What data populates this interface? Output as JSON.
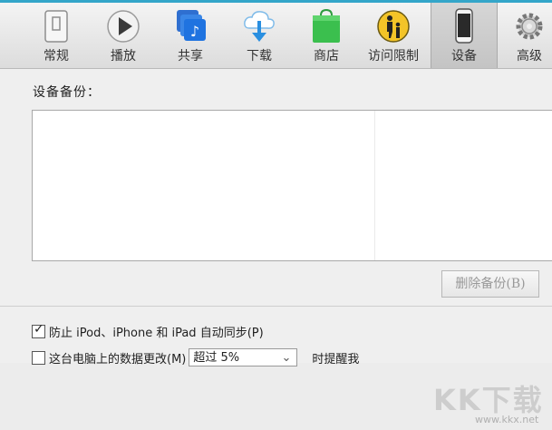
{
  "toolbar": {
    "items": [
      {
        "label": "常规",
        "icon": "general-icon"
      },
      {
        "label": "播放",
        "icon": "play-icon"
      },
      {
        "label": "共享",
        "icon": "sharing-icon"
      },
      {
        "label": "下载",
        "icon": "download-icon"
      },
      {
        "label": "商店",
        "icon": "store-icon"
      },
      {
        "label": "访问限制",
        "icon": "parental-icon"
      },
      {
        "label": "设备",
        "icon": "device-icon",
        "active": true
      },
      {
        "label": "高级",
        "icon": "gear-icon"
      }
    ],
    "accent": "#34a6c9"
  },
  "backups": {
    "label": "设备备份：",
    "delete_label": "删除备份(B)"
  },
  "options": {
    "prevent_sync_label": "防止 iPod、iPhone 和 iPad 自动同步(P)",
    "prevent_sync_checked": true,
    "data_change_label": "这台电脑上的数据更改(M)",
    "data_change_checked": false,
    "threshold_value": "超过 5%",
    "threshold_suffix": "时提醒我"
  },
  "watermark": {
    "brand": "KK下载",
    "url": "www.kkx.net"
  }
}
